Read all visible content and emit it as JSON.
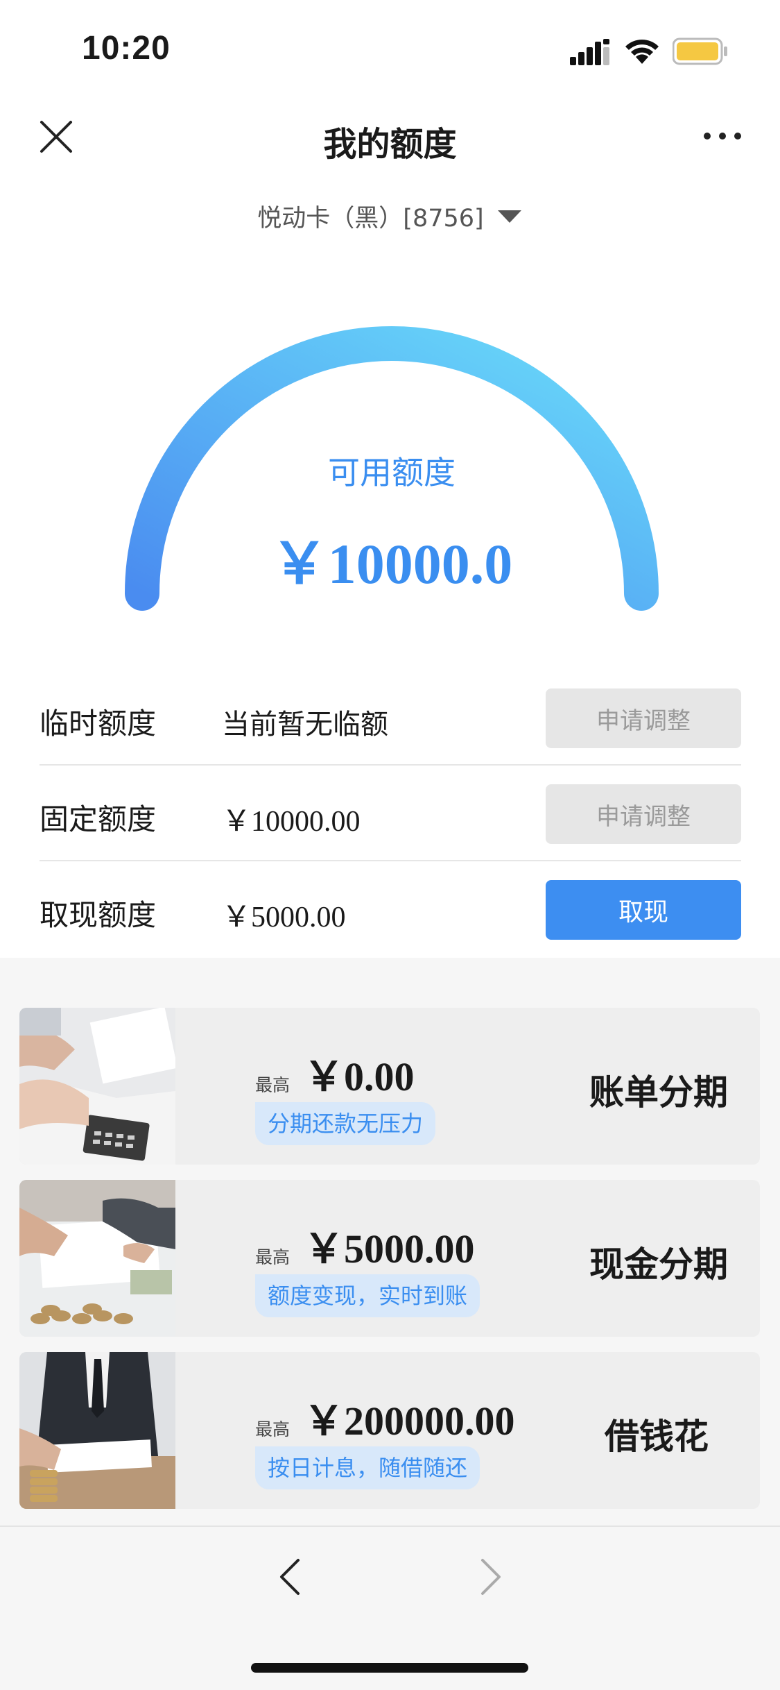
{
  "status_bar": {
    "time": "10:20",
    "icons": [
      "cellular-signal-icon",
      "wifi-icon",
      "battery-icon"
    ],
    "battery_color": "#f5c842"
  },
  "nav": {
    "title": "我的额度",
    "left_icon": "close-icon",
    "right_icon": "more-icon"
  },
  "card_selector": {
    "label": "悦动卡（黑）[8756]",
    "icon": "dropdown-triangle-icon"
  },
  "gauge": {
    "label": "可用额度",
    "value": "￥10000.0",
    "gradient_start": "#4a8cf0",
    "gradient_end": "#6adcfa"
  },
  "quotas": [
    {
      "label": "临时额度",
      "value": "当前暂无临额",
      "button": "申请调整",
      "button_enabled": false
    },
    {
      "label": "固定额度",
      "value": "￥10000.00",
      "button": "申请调整",
      "button_enabled": false
    },
    {
      "label": "取现额度",
      "value": "￥5000.00",
      "button": "取现",
      "button_enabled": true
    }
  ],
  "products": [
    {
      "prefix": "最高",
      "amount": "￥0.00",
      "tag": "分期还款无压力",
      "name": "账单分期"
    },
    {
      "prefix": "最高",
      "amount": "￥5000.00",
      "tag": "额度变现，实时到账",
      "name": "现金分期"
    },
    {
      "prefix": "最高",
      "amount": "￥200000.00",
      "tag": "按日计息，随借随还",
      "name": "借钱花"
    }
  ],
  "bottom_nav": {
    "back_icon": "chevron-left-icon",
    "forward_icon": "chevron-right-icon"
  },
  "colors": {
    "accent": "#3d8ef1",
    "disabled_button": "#e6e6e6"
  }
}
